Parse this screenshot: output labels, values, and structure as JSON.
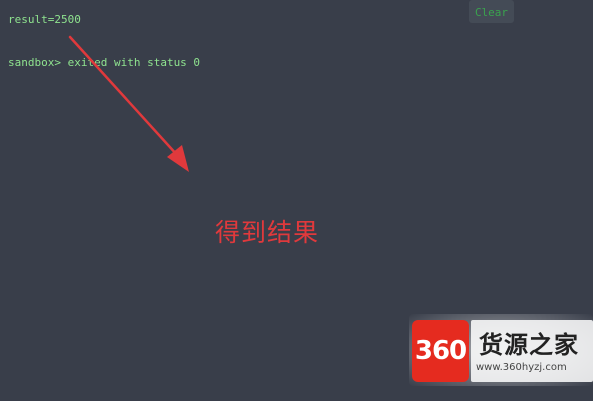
{
  "console": {
    "lines": [
      "result=2500",
      "sandbox> exited with status 0"
    ]
  },
  "toolbar": {
    "clear_label": "Clear"
  },
  "annotation": {
    "text": "得到结果",
    "color": "#e0393c"
  },
  "watermark": {
    "logo_text": "360",
    "title": "货源之家",
    "url": "www.360hyzj.com"
  },
  "colors": {
    "background": "#393e4a",
    "console_text": "#8fe38f",
    "clear_text": "#3aa24e",
    "logo_red": "#e52b1f"
  }
}
